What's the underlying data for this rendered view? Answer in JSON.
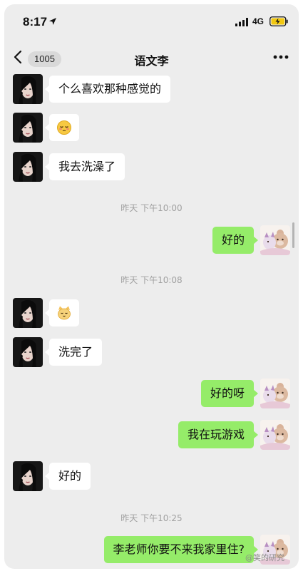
{
  "status": {
    "time": "8:17",
    "network": "4G",
    "location_icon": "location-arrow-icon",
    "signal_icon": "signal-bars-icon",
    "battery_icon": "battery-charging-icon"
  },
  "nav": {
    "back_count": "1005",
    "title": "语文李",
    "back_icon": "chevron-left-icon",
    "more_icon": "more-dots-icon"
  },
  "messages": [
    {
      "side": "left",
      "text": "个么喜欢那种感觉的"
    },
    {
      "side": "left",
      "emoji": "sleepy-face-emoji"
    },
    {
      "side": "left",
      "text": "我去洗澡了"
    },
    {
      "type": "time",
      "text": "昨天 下午10:00"
    },
    {
      "side": "right",
      "text": "好的"
    },
    {
      "type": "time",
      "text": "昨天 下午10:08"
    },
    {
      "side": "left",
      "emoji": "cat-face-emoji"
    },
    {
      "side": "left",
      "text": "洗完了"
    },
    {
      "side": "right",
      "text": "好的呀"
    },
    {
      "side": "right",
      "text": "我在玩游戏"
    },
    {
      "side": "left",
      "text": "好的"
    },
    {
      "type": "time",
      "text": "昨天 下午10:25"
    },
    {
      "side": "right",
      "text": "李老师你要不来我家里住?"
    }
  ],
  "watermark": "@笑的研究",
  "colors": {
    "chat_background": "#ededed",
    "outgoing_bubble": "#95ec69",
    "incoming_bubble": "#ffffff"
  }
}
